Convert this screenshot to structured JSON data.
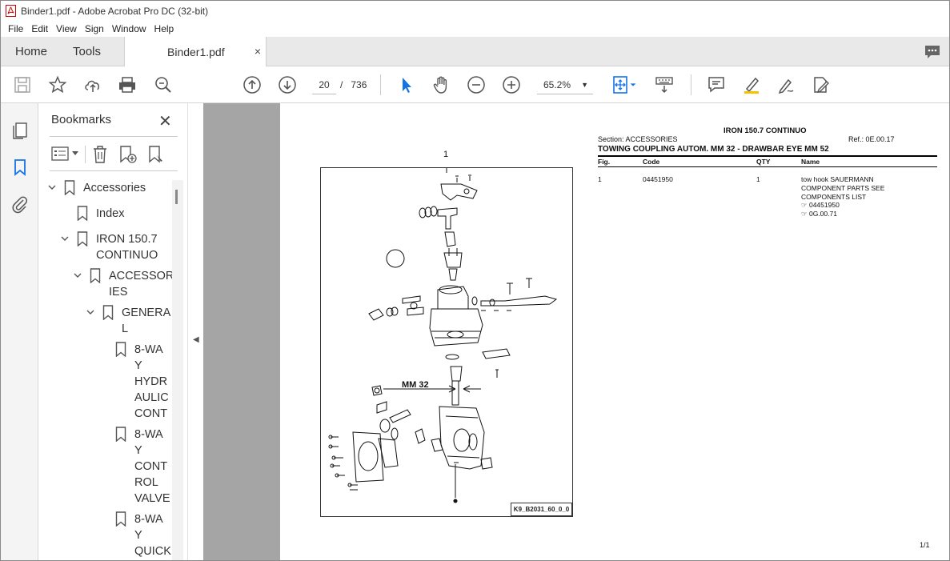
{
  "window": {
    "title": "Binder1.pdf - Adobe Acrobat Pro DC (32-bit)"
  },
  "menu": [
    "File",
    "Edit",
    "View",
    "Sign",
    "Window",
    "Help"
  ],
  "tabs": {
    "home": "Home",
    "tools": "Tools",
    "document": "Binder1.pdf",
    "close": "×"
  },
  "toolbar": {
    "page_current": "20",
    "page_separator": "/",
    "page_total": "736",
    "zoom": "65.2%"
  },
  "bookmarks": {
    "title": "Bookmarks",
    "items": [
      {
        "label": "Accessories",
        "level": 0,
        "expanded": true
      },
      {
        "label": "Index",
        "level": 1,
        "expanded": false
      },
      {
        "label": "IRON 150.7 CONTINUO",
        "level": 1,
        "expanded": true
      },
      {
        "label": "ACCESSORIES",
        "level": 2,
        "expanded": true
      },
      {
        "label": "GENERAL",
        "level": 3,
        "expanded": true
      },
      {
        "label": "8-WAY HYDRAULIC CONT",
        "level": 4,
        "expanded": false
      },
      {
        "label": "8-WAY CONTROL VALVE",
        "level": 4,
        "expanded": false
      },
      {
        "label": "8-WAY QUICK",
        "level": 4,
        "expanded": false
      }
    ]
  },
  "document": {
    "model": "IRON 150.7 CONTINUO",
    "section": "Section: ACCESSORIES",
    "ref": "Ref.: 0E.00.17",
    "heading": "TOWING COUPLING AUTOM. MM 32 - DRAWBAR EYE MM 52",
    "columns": [
      "Fig.",
      "Code",
      "QTY",
      "Name"
    ],
    "rows": [
      {
        "fig": "1",
        "code": "04451950",
        "qty": "1",
        "name": [
          "tow hook SAUERMANN",
          "COMPONENT PARTS SEE",
          "COMPONENTS LIST",
          "☞ 04451950",
          "☞ 0G.00.71"
        ]
      }
    ],
    "figure_number": "1",
    "figure_label": "MM 32",
    "figure_code": "K9_B2031_60_0_0",
    "page_counter": "1/1"
  }
}
